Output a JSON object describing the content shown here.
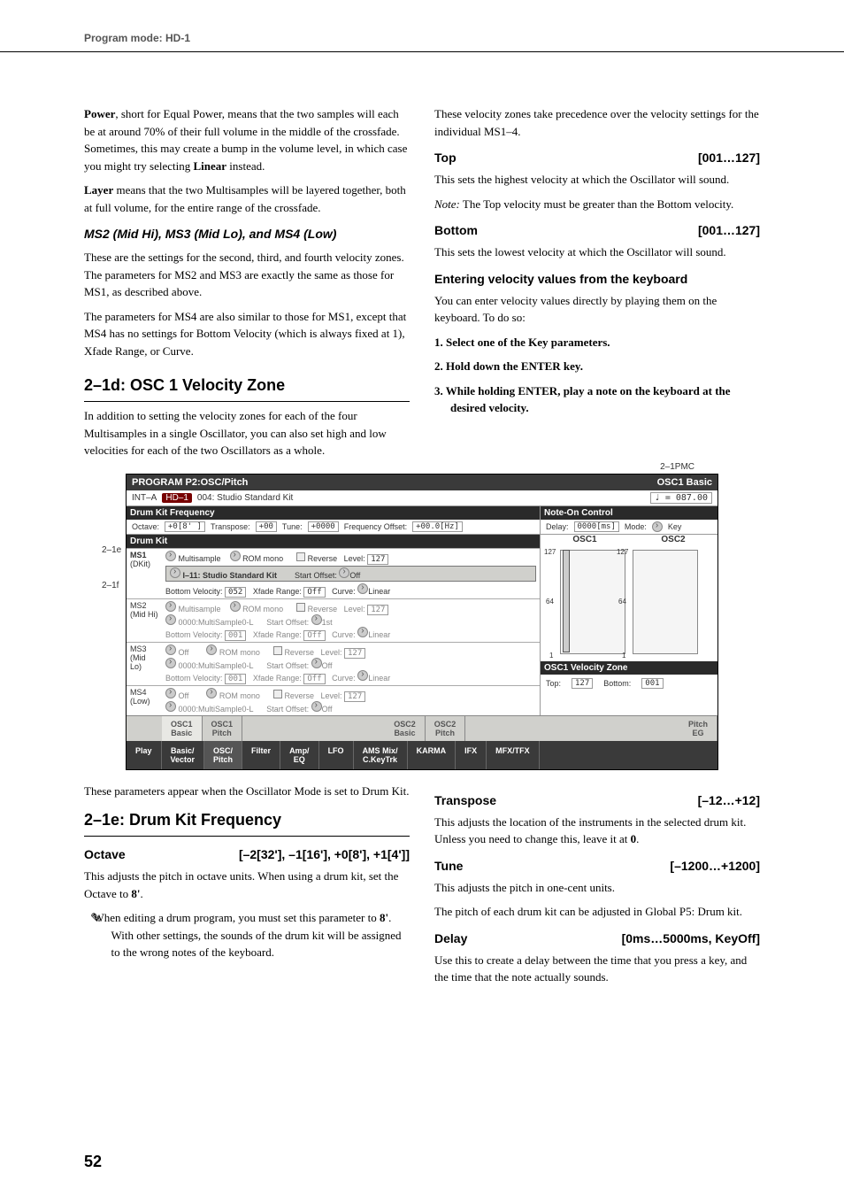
{
  "header": "Program mode: HD-1",
  "pageNumber": "52",
  "left1": {
    "p1a": "Power",
    "p1b": ", short for Equal Power, means that the two samples will each be at around 70% of their full volume in the middle of the crossfade. Sometimes, this may create a bump in the volume level, in which case you might try selecting ",
    "p1c": "Linear",
    "p1d": " instead.",
    "p2a": "Layer",
    "p2b": " means that the two Multisamples will be layered together, both at full volume, for the entire range of the crossfade.",
    "h1": "MS2 (Mid Hi), MS3 (Mid Lo), and MS4 (Low)",
    "p3": "These are the settings for the second, third, and fourth velocity zones. The parameters for MS2 and MS3 are exactly the same as those for MS1, as described above.",
    "p4": "The parameters for MS4 are also similar to those for MS1, except that MS4 has no settings for Bottom Velocity (which is always fixed at 1), Xfade Range, or Curve.",
    "h2": "2–1d: OSC 1 Velocity Zone",
    "p5": "In addition to setting the velocity zones for each of the four Multisamples in a single Oscillator, you can also set high and low velocities for each of the two Oscillators as a whole."
  },
  "right1": {
    "p1": "These velocity zones take precedence over the velocity settings for the individual MS1–4.",
    "topLabel": "Top",
    "topRange": "[001…127]",
    "p2": "This sets the highest velocity at which the Oscillator will sound.",
    "p3a": "Note:",
    "p3b": " The Top velocity must be greater than the Bottom velocity.",
    "botLabel": "Bottom",
    "botRange": "[001…127]",
    "p4": "This sets the lowest velocity at which the Oscillator will sound.",
    "subh": "Entering velocity values from the keyboard",
    "p5": "You can enter velocity values directly by playing them on the keyboard. To do so:",
    "li1": "1.  Select one of the Key parameters.",
    "li2": "2.  Hold down the ENTER key.",
    "li3": "3.  While holding ENTER, play a note on the keyboard at the desired velocity."
  },
  "ss": {
    "label2e": "2–1e",
    "label2f": "2–1f",
    "labelPmc": "2–1PMC",
    "title_l": "PROGRAM P2:OSC/Pitch",
    "title_r": "OSC1 Basic",
    "int": "INT–A",
    "hd1": "HD–1",
    "progname": "004: Studio Standard Kit",
    "tempo_lbl": "♩ =",
    "tempo_val": "087.00",
    "drumkit_freq": "Drum Kit Frequency",
    "noteon": "Note-On Control",
    "octave_l": "Octave:",
    "octave_v": "+0[8' ]",
    "transpose_l": "Transpose:",
    "transpose_v": "+00",
    "tune_l": "Tune:",
    "tune_v": "+0000",
    "freqoff_l": "Frequency Offset:",
    "freqoff_v": "+00.0[Hz]",
    "delay_l": "Delay:",
    "delay_v": "0000[ms]",
    "mode_l": "Mode:",
    "mode_v": "Key",
    "drumkit": "Drum Kit",
    "osc1g": "OSC1",
    "osc2g": "OSC2",
    "ms1": "MS1",
    "ms1b": "(DKit)",
    "ms2": "MS2",
    "ms2b": "(Mid Hi)",
    "ms3": "MS3",
    "ms3b": "(Mid Lo)",
    "ms4": "MS4",
    "ms4b": "(Low)",
    "multisample": "Multisample",
    "off": "Off",
    "rommono": "ROM mono",
    "kitname": "I–11: Studio Standard Kit",
    "msname0": "0000:MultiSample0-L",
    "reverse_l": "Reverse",
    "level_l": "Level:",
    "level_v": "127",
    "startoff_l": "Start Offset:",
    "startoff_v_off": "Off",
    "startoff_v_1st": "1st",
    "botvel_l": "Bottom Velocity:",
    "botvel_v1": "052",
    "botvel_v2": "001",
    "xfade_l": "Xfade Range:",
    "xfade_v": "Off",
    "curve_l": "Curve:",
    "curve_v": "Linear",
    "y127": "127",
    "y64": "64",
    "y1": "1",
    "vzone_h": "OSC1 Velocity Zone",
    "vtop_l": "Top:",
    "vtop_v": "127",
    "vbot_l": "Bottom:",
    "vbot_v": "001",
    "tab_o1b": "OSC1\nBasic",
    "tab_o1p": "OSC1\nPitch",
    "tab_o2b": "OSC2\nBasic",
    "tab_o2p": "OSC2\nPitch",
    "tab_peq": "Pitch\nEG",
    "btab_play": "Play",
    "btab_bv": "Basic/\nVector",
    "btab_op": "OSC/\nPitch",
    "btab_f": "Filter",
    "btab_ae": "Amp/\nEQ",
    "btab_lfo": "LFO",
    "btab_ams": "AMS Mix/\nC.KeyTrk",
    "btab_k": "KARMA",
    "btab_ifx": "IFX",
    "btab_mfx": "MFX/TFX"
  },
  "left2": {
    "p1": "These parameters appear when the Oscillator Mode is set to Drum Kit.",
    "h1": "2–1e:  Drum Kit Frequency",
    "octLabel": "Octave",
    "octRange": "[–2[32'], –1[16'], +0[8'], +1[4']]",
    "p2a": "This adjusts the pitch in octave units. When using a drum kit, set the Octave to ",
    "p2b": "8'",
    "p2c": ".",
    "p3a": "When editing a drum program, you must set this parameter to ",
    "p3b": "8'",
    "p3c": ". With other settings, the sounds of the drum kit will be assigned to the wrong notes of the keyboard."
  },
  "right2": {
    "trLabel": "Transpose",
    "trRange": "[–12…+12]",
    "p1a": "This adjusts the location of the instruments in the selected drum kit. Unless you need to change this, leave it at ",
    "p1b": "0",
    "p1c": ".",
    "tuLabel": "Tune",
    "tuRange": "[–1200…+1200]",
    "p2": "This adjusts the pitch in one-cent units.",
    "p3": "The pitch of each drum kit can be adjusted in Global P5: Drum kit.",
    "dlLabel": "Delay",
    "dlRange": "[0ms…5000ms, KeyOff]",
    "p4": "Use this to create a delay between the time that you press a key, and the time that the note actually sounds."
  }
}
